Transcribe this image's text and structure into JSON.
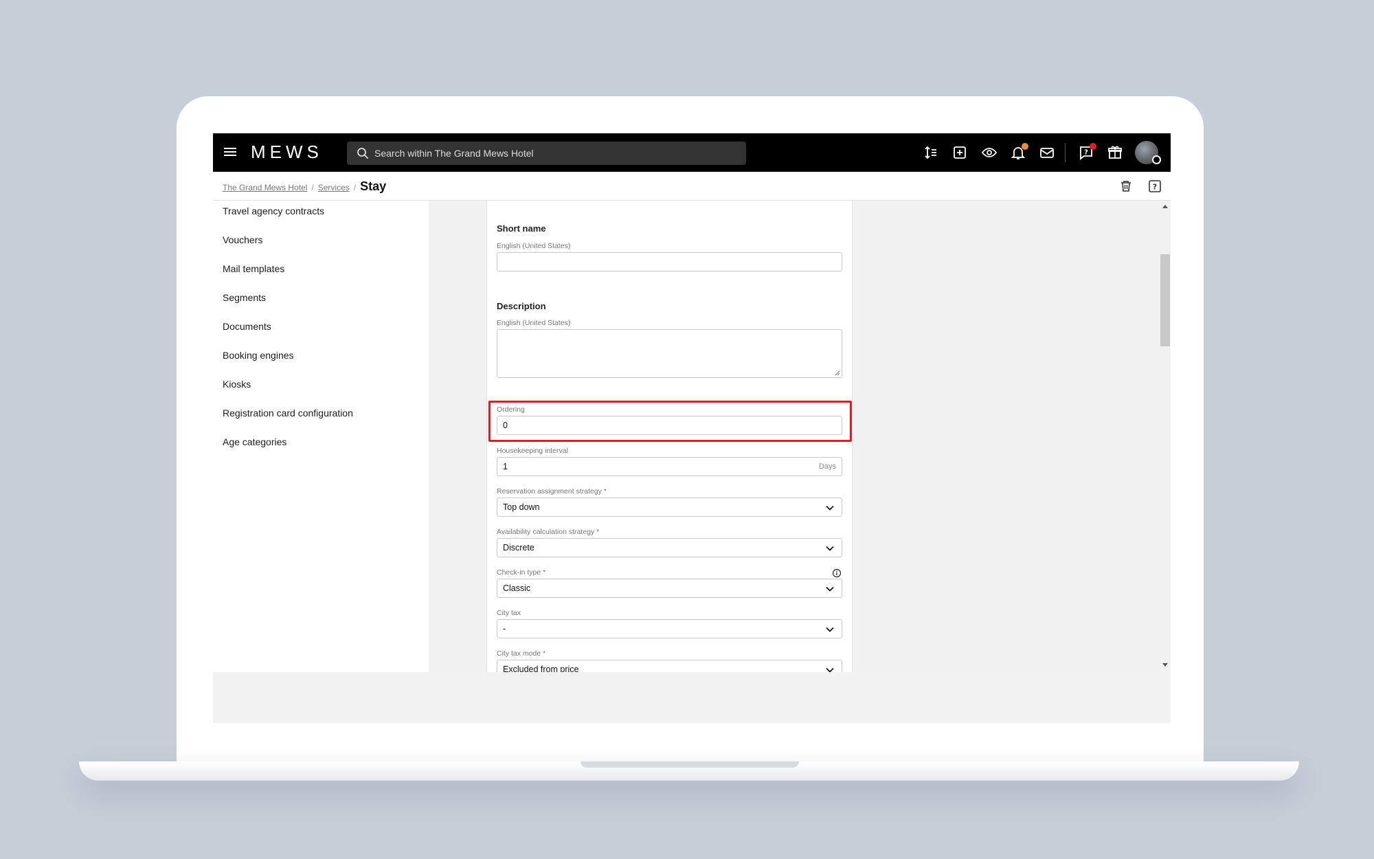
{
  "topbar": {
    "logo": "MEWS",
    "search_placeholder": "Search within The Grand Mews Hotel",
    "icons": [
      "sort-icon",
      "add-icon",
      "eye-icon",
      "bell-icon",
      "mail-icon",
      "help-icon",
      "gift-icon"
    ],
    "colors": {
      "bar": "#000000",
      "notification_dot": "#f08a3e",
      "help_dot": "#e31c23"
    }
  },
  "breadcrumb": {
    "items": [
      "The Grand Mews Hotel",
      "Services"
    ],
    "separator": "/",
    "current": "Stay"
  },
  "sidebar": {
    "items": [
      "Travel agency contracts",
      "Vouchers",
      "Mail templates",
      "Segments",
      "Documents",
      "Booking engines",
      "Kiosks",
      "Registration card configuration",
      "Age categories"
    ]
  },
  "form": {
    "short_name": {
      "title": "Short name",
      "label": "English (United States)",
      "value": ""
    },
    "description": {
      "title": "Description",
      "label": "English (United States)",
      "value": ""
    },
    "ordering": {
      "label": "Ordering",
      "value": "0"
    },
    "housekeeping_interval": {
      "label": "Housekeeping interval",
      "value": "1",
      "suffix": "Days"
    },
    "reservation_assignment_strategy": {
      "label": "Reservation assignment strategy *",
      "value": "Top down"
    },
    "availability_calculation_strategy": {
      "label": "Availability calculation strategy *",
      "value": "Discrete"
    },
    "check_in_type": {
      "label": "Check-in type *",
      "value": "Classic"
    },
    "city_tax": {
      "label": "City tax",
      "value": "-"
    },
    "city_tax_mode": {
      "label": "City tax mode *",
      "value": "Excluded from price"
    }
  },
  "highlight_color": "#e31c23"
}
